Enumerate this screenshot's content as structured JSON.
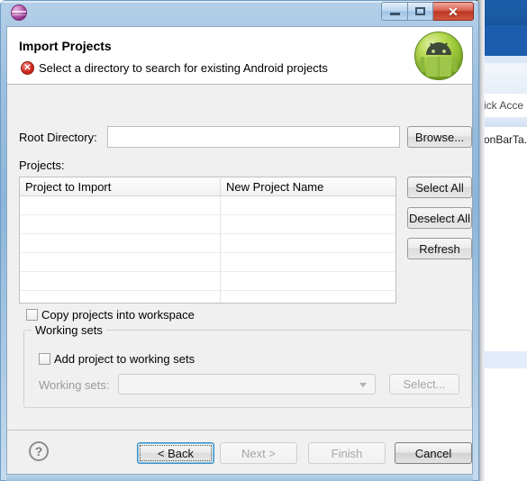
{
  "window": {
    "app_icon": "eclipse-sphere-icon",
    "minimize_label": "Minimize",
    "maximize_label": "Restore",
    "close_label": "✕"
  },
  "header": {
    "title": "Import Projects",
    "message": "Select a directory to search for existing Android projects",
    "status_icon": "error-icon",
    "status_icon_glyph": "✕",
    "brand_icon": "android-robot-icon"
  },
  "form": {
    "root_directory_label": "Root Directory:",
    "root_directory_value": "",
    "root_directory_placeholder": "",
    "browse_label": "Browse...",
    "projects_label": "Projects:"
  },
  "table": {
    "columns": [
      "Project to Import",
      "New Project Name"
    ],
    "rows": [],
    "empty_row_count": 6
  },
  "list_buttons": {
    "select_all": "Select All",
    "deselect_all": "Deselect All",
    "refresh": "Refresh"
  },
  "options": {
    "copy_projects_label": "Copy projects into workspace",
    "copy_projects_checked": false
  },
  "working_sets": {
    "group_title": "Working sets",
    "add_project_label": "Add project to working sets",
    "add_project_checked": false,
    "combo_label": "Working sets:",
    "combo_value": "",
    "combo_enabled": false,
    "select_label": "Select...",
    "select_enabled": false
  },
  "footer": {
    "help_glyph": "?",
    "back_label": "< Back",
    "next_label": "Next >",
    "finish_label": "Finish",
    "cancel_label": "Cancel",
    "back_enabled": true,
    "next_enabled": false,
    "finish_enabled": false,
    "cancel_enabled": true
  },
  "background": {
    "quick_access_text": "ick Acce",
    "editor_text": "onBarTa."
  },
  "colors": {
    "title_gradient_top": "#b4cfe8",
    "close_button_red": "#bc3823",
    "dialog_face": "#f0f0f0",
    "error_red": "#d62b1f",
    "android_green": "#bada55",
    "focus_blue": "#3c8ec4",
    "eclipse_purple": "#93368c",
    "bg_eclipse_blue": "#1b5da8"
  }
}
